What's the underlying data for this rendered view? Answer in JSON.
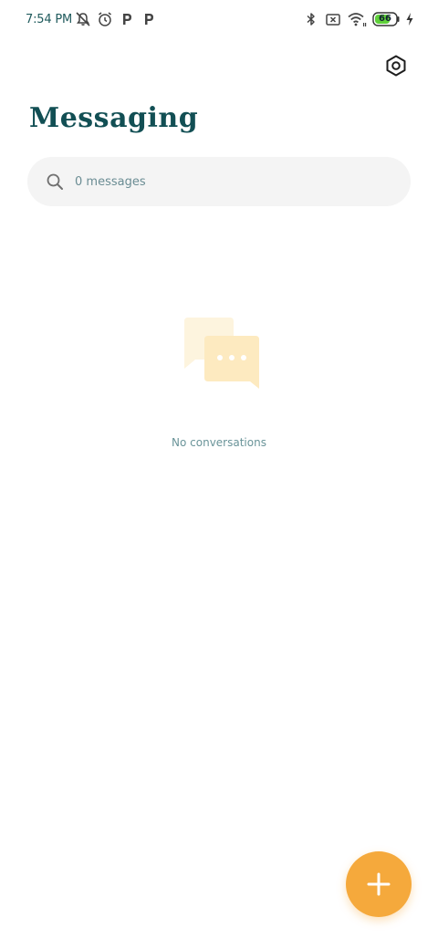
{
  "status_bar": {
    "time": "7:54 PM",
    "battery_level": "66",
    "left_icons": [
      "mute-notifications-icon",
      "alarm-icon",
      "parking-app-icon",
      "parking-app-icon"
    ],
    "right_icons": [
      "bluetooth-icon",
      "no-sim-icon",
      "wifi-icon",
      "battery-icon",
      "charging-icon"
    ]
  },
  "header": {
    "title": "Messaging",
    "settings_icon": "settings-hex-icon"
  },
  "search": {
    "placeholder": "0 messages",
    "icon": "search-icon"
  },
  "empty_state": {
    "message": "No conversations",
    "icon": "chat-bubbles-icon"
  },
  "fab": {
    "icon": "plus-icon"
  },
  "colors": {
    "accent": "#f5a93c",
    "title": "#124f54",
    "search_bg": "#f4f4f4",
    "muted_text": "#6a9499",
    "illustration": "#fdeec9"
  }
}
